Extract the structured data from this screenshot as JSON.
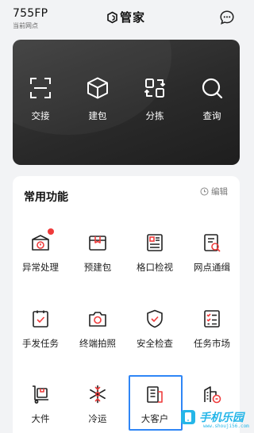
{
  "header": {
    "station_code": "755FP",
    "station_sub": "当前网点",
    "brand_name": "管家",
    "message_icon": "chat-bubble-icon"
  },
  "hero_actions": [
    {
      "label": "交接",
      "icon": "scan-frame-icon"
    },
    {
      "label": "建包",
      "icon": "package-cube-icon"
    },
    {
      "label": "分拣",
      "icon": "sort-exchange-icon"
    },
    {
      "label": "查询",
      "icon": "search-icon"
    }
  ],
  "common": {
    "title": "常用功能",
    "edit_label": "编辑",
    "items": [
      {
        "label": "异常处理",
        "icon": "exception-box-icon",
        "badge": true
      },
      {
        "label": "预建包",
        "icon": "prebuild-box-icon"
      },
      {
        "label": "格口检视",
        "icon": "grid-cell-icon"
      },
      {
        "label": "网点通缉",
        "icon": "wanted-doc-icon"
      },
      {
        "label": "手发任务",
        "icon": "task-check-icon"
      },
      {
        "label": "终端拍照",
        "icon": "camera-icon"
      },
      {
        "label": "安全检查",
        "icon": "shield-check-icon"
      },
      {
        "label": "任务市场",
        "icon": "task-list-icon"
      },
      {
        "label": "大件",
        "icon": "hand-truck-icon"
      },
      {
        "label": "冷运",
        "icon": "snowflake-icon"
      },
      {
        "label": "大客户",
        "icon": "building-doc-icon"
      },
      {
        "label": "",
        "icon": "building-tag-icon"
      }
    ]
  },
  "watermark": {
    "text": "手机乐园",
    "url": "www.shouji56.com"
  },
  "colors": {
    "accent_red": "#ef3b3b",
    "highlight_blue": "#2f86f6",
    "hero_dark": "#2a2a2a"
  }
}
